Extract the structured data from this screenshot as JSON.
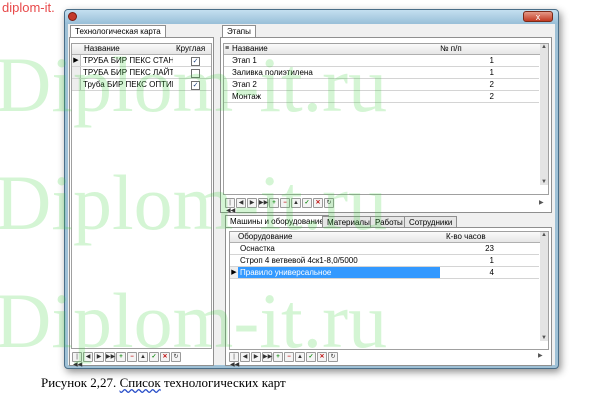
{
  "watermark": {
    "corner": "diplom-it.",
    "repeated": "Diplom-it.ru"
  },
  "window": {
    "close_symbol": "x"
  },
  "left_panel": {
    "tab": "Технологическая карта",
    "columns": [
      "Название",
      "Круглая"
    ],
    "rows": [
      {
        "name": "ТРУБА БИР ПЕКС СТАНДАР",
        "round": true,
        "current": true
      },
      {
        "name": "ТРУБА БИР ПЕКС ЛАЙТ",
        "round": false,
        "current": false
      },
      {
        "name": "Труба БИР ПЕКС ОПТИМА",
        "round": true,
        "current": false
      }
    ]
  },
  "stages_panel": {
    "tab": "Этапы",
    "columns": [
      "Название",
      "№ п/п"
    ],
    "rows": [
      {
        "name": "Этап 1",
        "num": "1"
      },
      {
        "name": "Заливка полиэтилена",
        "num": "1"
      },
      {
        "name": "Этап 2",
        "num": "2"
      },
      {
        "name": "Монтаж",
        "num": "2"
      }
    ]
  },
  "bottom_tabs": [
    "Машины и оборудование",
    "Материалы",
    "Работы",
    "Сотрудники"
  ],
  "equipment_panel": {
    "columns": [
      "Оборудование",
      "К-во часов"
    ],
    "rows": [
      {
        "name": "Оснастка",
        "hours": "23"
      },
      {
        "name": "Строп 4 ветвевой 4ск1-8,0/5000",
        "hours": "1"
      },
      {
        "name": "Правило универсальное",
        "hours": "4",
        "selected": true
      }
    ]
  },
  "navigator": {
    "buttons": [
      {
        "name": "first",
        "glyph": "|◀◀"
      },
      {
        "name": "prior",
        "glyph": "◀"
      },
      {
        "name": "next",
        "glyph": "▶"
      },
      {
        "name": "last",
        "glyph": "▶▶|"
      },
      {
        "name": "insert",
        "glyph": "+"
      },
      {
        "name": "delete",
        "glyph": "−"
      },
      {
        "name": "edit",
        "glyph": "▲"
      },
      {
        "name": "post",
        "glyph": "✓"
      },
      {
        "name": "cancel",
        "glyph": "✕"
      },
      {
        "name": "refresh",
        "glyph": "↻"
      }
    ]
  },
  "caption": {
    "prefix": "Рисунок 2,27. ",
    "underlined": "Список",
    "rest": " технологических карт"
  }
}
